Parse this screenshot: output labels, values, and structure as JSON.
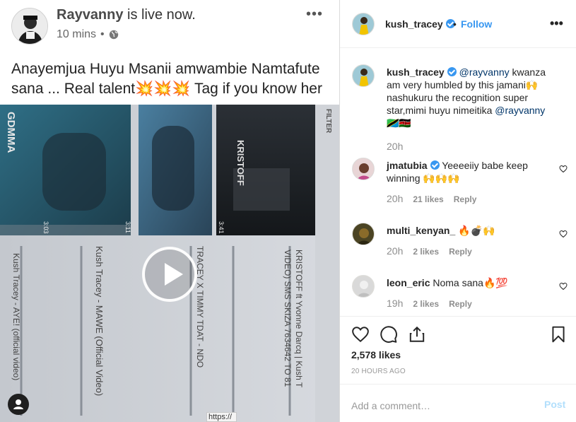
{
  "fb_post": {
    "author": "Rayvanny",
    "status": " is live now.",
    "time": "10 mins",
    "time_separator": "•",
    "more": "•••",
    "caption": "Anayemjua Huyu Msanii amwambie Namtafute sana ... Real talent💥💥💥 Tag if you know her",
    "video": {
      "overlay_texts": [
        "GDMMA",
        "KRISTOFF",
        "FILTER",
        "Kush Tracey - MAWE (Official Video)",
        "Kush Tracey - AYE! (official video)",
        "KRISTOFF ft Yvonne Darcq | Kush T",
        "VIDEO) SMS SKIZA 7634642 TO 81",
        "TRACEY X TIMMY TDAT - NDO",
        "3:11",
        "3:41",
        "3:03"
      ]
    }
  },
  "ig": {
    "username": "kush_tracey",
    "separator": "•",
    "follow": "Follow",
    "more": "•••",
    "caption": {
      "user": "kush_tracey",
      "mention1": "@rayvanny",
      "text1": " kwanza am very humbled by this jamani🙌 nashukuru the recognition super star,mimi huyu nimeitika ",
      "mention2": "@rayvanny",
      "text2": " 🇹🇿🇰🇪",
      "time": "20h"
    },
    "comments": [
      {
        "user": "jmatubia",
        "verified": true,
        "text": " Yeeeeiiy babe keep winning 🙌🙌🙌",
        "time": "20h",
        "likes": "21 likes",
        "reply": "Reply"
      },
      {
        "user": "multi_kenyan_",
        "verified": false,
        "text": " 🔥💣🙌",
        "time": "20h",
        "likes": "2 likes",
        "reply": "Reply"
      },
      {
        "user": "leon_eric",
        "verified": false,
        "text": " Noma sana🔥💯",
        "time": "19h",
        "likes": "2 likes",
        "reply": "Reply"
      }
    ],
    "likes_count": "2,578 likes",
    "time_ago": "20 HOURS AGO",
    "add_comment_placeholder": "Add a comment…",
    "post_label": "Post",
    "status_url": "https://"
  },
  "colors": {
    "link_blue": "#3897f0",
    "mention_blue": "#003569",
    "muted": "#8e8e8e",
    "post_disabled": "#b2dffc"
  },
  "icons": [
    "globe-icon",
    "play-icon",
    "user-icon",
    "verified-icon",
    "heart-icon",
    "comment-icon",
    "share-icon",
    "bookmark-icon"
  ]
}
